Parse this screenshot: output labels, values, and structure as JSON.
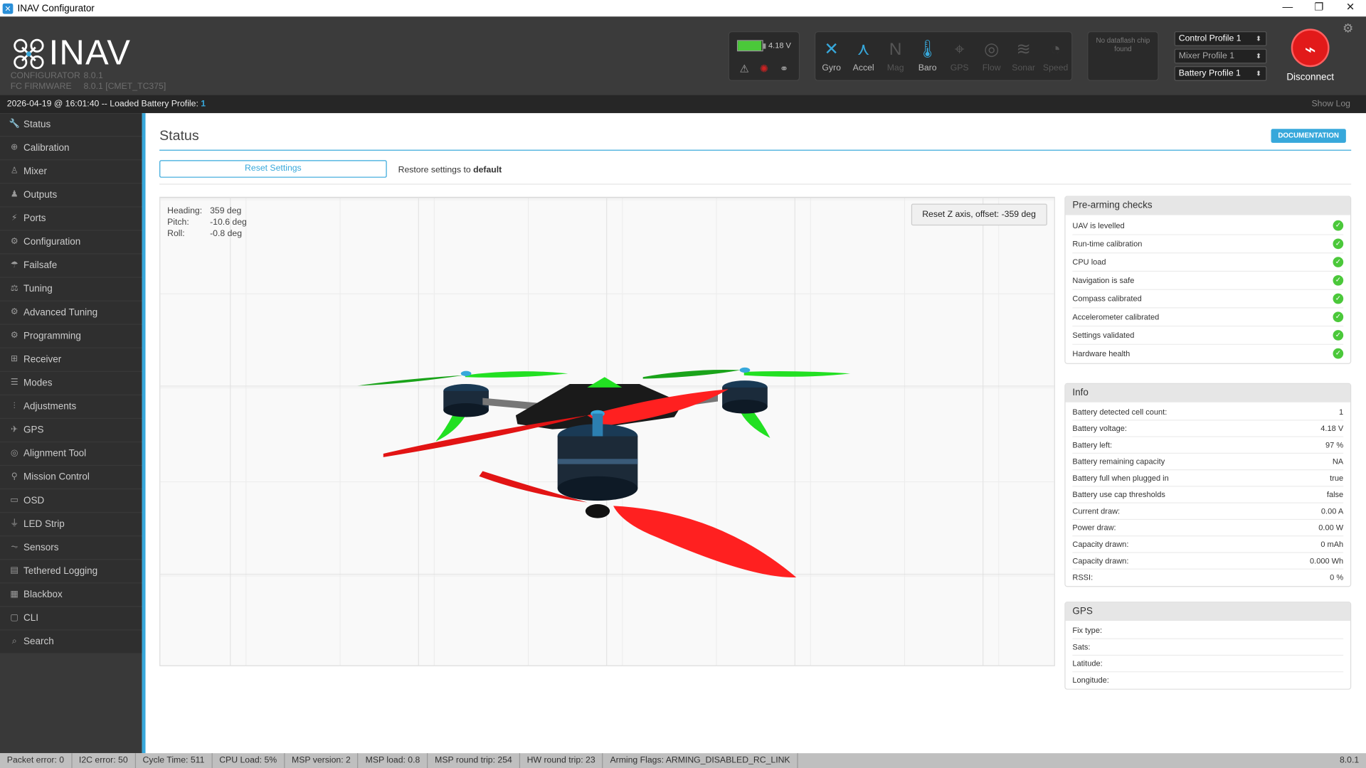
{
  "window": {
    "title": "INAV Configurator",
    "minimize": "—",
    "restore": "❐",
    "close": "✕"
  },
  "header": {
    "logo_text": "INAV",
    "configurator_label": "CONFIGURATOR",
    "configurator_version": "8.0.1",
    "firmware_label": "FC FIRMWARE",
    "firmware_version": "8.0.1 [CMET_TC375]",
    "battery_voltage": "4.18 V",
    "battery_fill": 0.97,
    "sensors": [
      {
        "label": "Gyro",
        "icon": "gyro-icon",
        "glyph": "✕",
        "active": true
      },
      {
        "label": "Accel",
        "icon": "accel-icon",
        "glyph": "⋏",
        "active": true
      },
      {
        "label": "Mag",
        "icon": "mag-icon",
        "glyph": "N",
        "active": false
      },
      {
        "label": "Baro",
        "icon": "baro-icon",
        "glyph": "🌡",
        "active": true
      },
      {
        "label": "GPS",
        "icon": "gps-icon",
        "glyph": "⌖",
        "active": false
      },
      {
        "label": "Flow",
        "icon": "flow-icon",
        "glyph": "◎",
        "active": false
      },
      {
        "label": "Sonar",
        "icon": "sonar-icon",
        "glyph": "≋",
        "active": false
      },
      {
        "label": "Speed",
        "icon": "speed-icon",
        "glyph": "◔",
        "active": false
      }
    ],
    "dataflash_text": "No dataflash chip found",
    "profiles": [
      {
        "label": "Control Profile 1",
        "dim": false
      },
      {
        "label": "Mixer Profile 1",
        "dim": true
      },
      {
        "label": "Battery Profile 1",
        "dim": false
      }
    ],
    "disconnect_label": "Disconnect"
  },
  "log": {
    "text": "2026-04-19 @ 16:01:40 -- Loaded Battery Profile:",
    "value": "1",
    "show_log": "Show Log"
  },
  "sidebar": {
    "items": [
      {
        "label": "Status",
        "icon": "wrench-icon",
        "glyph": "🔧"
      },
      {
        "label": "Calibration",
        "icon": "crosshair-icon",
        "glyph": "⊕"
      },
      {
        "label": "Mixer",
        "icon": "mixer-icon",
        "glyph": "♙"
      },
      {
        "label": "Outputs",
        "icon": "outputs-icon",
        "glyph": "♟"
      },
      {
        "label": "Ports",
        "icon": "plug-icon",
        "glyph": "⚡"
      },
      {
        "label": "Configuration",
        "icon": "gear-icon",
        "glyph": "⚙"
      },
      {
        "label": "Failsafe",
        "icon": "parachute-icon",
        "glyph": "☂"
      },
      {
        "label": "Tuning",
        "icon": "tuning-icon",
        "glyph": "⚖"
      },
      {
        "label": "Advanced Tuning",
        "icon": "advanced-tuning-icon",
        "glyph": "⚙"
      },
      {
        "label": "Programming",
        "icon": "programming-icon",
        "glyph": "⚙"
      },
      {
        "label": "Receiver",
        "icon": "receiver-icon",
        "glyph": "⊞"
      },
      {
        "label": "Modes",
        "icon": "modes-icon",
        "glyph": "☰"
      },
      {
        "label": "Adjustments",
        "icon": "adjustments-icon",
        "glyph": "⫶"
      },
      {
        "label": "GPS",
        "icon": "satellite-icon",
        "glyph": "✈"
      },
      {
        "label": "Alignment Tool",
        "icon": "compass-icon",
        "glyph": "◎"
      },
      {
        "label": "Mission Control",
        "icon": "map-pin-icon",
        "glyph": "⚲"
      },
      {
        "label": "OSD",
        "icon": "osd-icon",
        "glyph": "▭"
      },
      {
        "label": "LED Strip",
        "icon": "led-icon",
        "glyph": "⏚"
      },
      {
        "label": "Sensors",
        "icon": "sensors-icon",
        "glyph": "⏦"
      },
      {
        "label": "Tethered Logging",
        "icon": "tethered-logging-icon",
        "glyph": "▤"
      },
      {
        "label": "Blackbox",
        "icon": "blackbox-icon",
        "glyph": "▦"
      },
      {
        "label": "CLI",
        "icon": "cli-icon",
        "glyph": "▢"
      },
      {
        "label": "Search",
        "icon": "search-icon",
        "glyph": "⌕"
      }
    ]
  },
  "main": {
    "title": "Status",
    "documentation": "DOCUMENTATION",
    "reset_settings": "Reset Settings",
    "restore_prefix": "Restore settings to",
    "restore_value": "default",
    "attitude": {
      "heading_label": "Heading:",
      "heading": "359 deg",
      "pitch_label": "Pitch:",
      "pitch": "-10.6 deg",
      "roll_label": "Roll:",
      "roll": "-0.8 deg"
    },
    "reset_z": "Reset Z axis, offset: -359 deg"
  },
  "prearming": {
    "title": "Pre-arming checks",
    "items": [
      "UAV is levelled",
      "Run-time calibration",
      "CPU load",
      "Navigation is safe",
      "Compass calibrated",
      "Accelerometer calibrated",
      "Settings validated",
      "Hardware health"
    ]
  },
  "info": {
    "title": "Info",
    "rows": [
      {
        "label": "Battery detected cell count:",
        "value": "1"
      },
      {
        "label": "Battery voltage:",
        "value": "4.18 V"
      },
      {
        "label": "Battery left:",
        "value": "97 %"
      },
      {
        "label": "Battery remaining capacity",
        "value": "NA"
      },
      {
        "label": "Battery full when plugged in",
        "value": "true"
      },
      {
        "label": "Battery use cap thresholds",
        "value": "false"
      },
      {
        "label": "Current draw:",
        "value": "0.00 A"
      },
      {
        "label": "Power draw:",
        "value": "0.00 W"
      },
      {
        "label": "Capacity drawn:",
        "value": "0 mAh"
      },
      {
        "label": "Capacity drawn:",
        "value": "0.000 Wh"
      },
      {
        "label": "RSSI:",
        "value": "0 %"
      }
    ]
  },
  "gps": {
    "title": "GPS",
    "rows": [
      {
        "label": "Fix type:",
        "value": ""
      },
      {
        "label": "Sats:",
        "value": ""
      },
      {
        "label": "Latitude:",
        "value": ""
      },
      {
        "label": "Longitude:",
        "value": ""
      }
    ]
  },
  "statusbar": {
    "segments": [
      "Packet error: 0",
      "I2C error: 50",
      "Cycle Time: 511",
      "CPU Load: 5%",
      "MSP version: 2",
      "MSP load: 0.8",
      "MSP round trip: 254",
      "HW round trip: 23",
      "Arming Flags: ARMING_DISABLED_RC_LINK"
    ],
    "version": "8.0.1"
  }
}
